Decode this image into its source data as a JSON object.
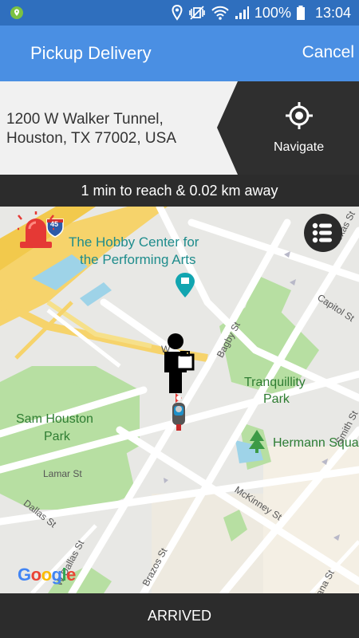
{
  "status_bar": {
    "battery": "100%",
    "time": "13:04"
  },
  "app_bar": {
    "title": "Pickup Delivery",
    "cancel_label": "Cancel"
  },
  "address": {
    "line1": "1200 W Walker Tunnel,",
    "line2": "Houston, TX 77002, USA"
  },
  "navigate": {
    "label": "Navigate"
  },
  "eta": {
    "text": "1 min to reach & 0.02 km away"
  },
  "map": {
    "labels": {
      "hobby_center_1": "The Hobby Center for",
      "hobby_center_2": "the Performing Arts",
      "tranquillity_1": "Tranquillity",
      "tranquillity_2": "Park",
      "sam_houston_1": "Sam Houston",
      "sam_houston_2": "Park",
      "hermann": "Hermann Squa",
      "lamar": "Lamar St",
      "dallas": "Dallas St",
      "w_dallas": "W Dallas St",
      "brazos": "Brazos St",
      "bagby": "Bagby St",
      "capitol": "Capitol St",
      "smith": "Smith St",
      "mckinney": "McKinney St",
      "texas": "Texas St",
      "louisiana": "ana St",
      "walker": "W",
      "highway": "45"
    },
    "google_logo": [
      "G",
      "o",
      "o",
      "g",
      "l",
      "e"
    ]
  },
  "arrived": {
    "label": "ARRIVED"
  },
  "colors": {
    "status_bar": "#2f6fbe",
    "app_bar": "#4a8fe3",
    "dark": "#2c2c2c",
    "park": "#b7dfa2",
    "water": "#9ed3e8",
    "highway": "#f6d36b"
  }
}
